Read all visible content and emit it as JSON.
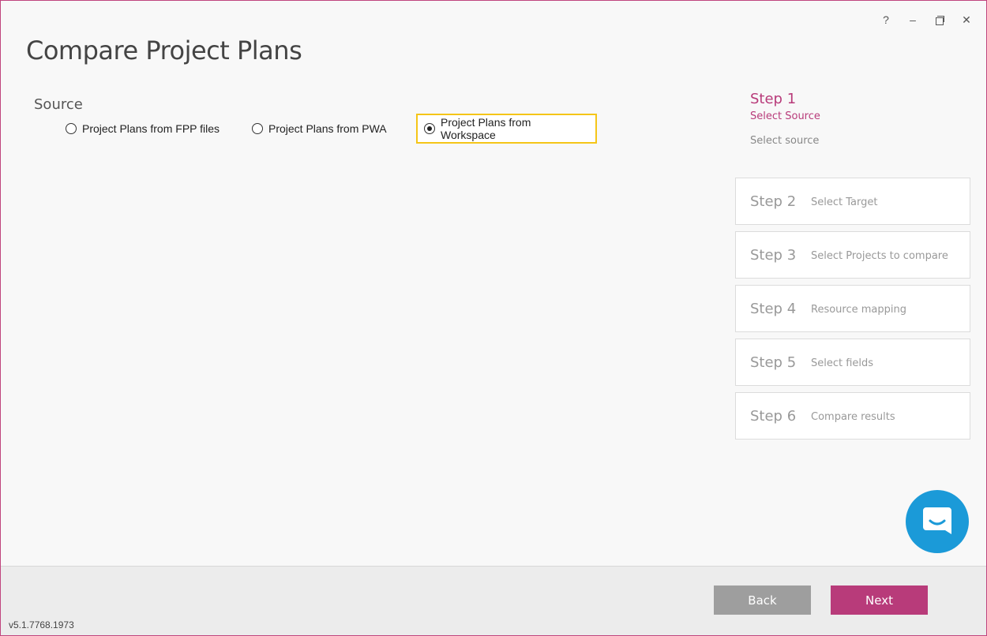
{
  "window": {
    "controls": {
      "help": "?",
      "minimize": "–",
      "close": "✕"
    }
  },
  "page": {
    "title": "Compare Project Plans"
  },
  "source": {
    "label": "Source",
    "options": [
      {
        "label": "Project Plans from FPP files",
        "selected": false
      },
      {
        "label": "Project Plans from PWA",
        "selected": false
      },
      {
        "label": "Project Plans from Workspace",
        "selected": true
      }
    ]
  },
  "steps": {
    "active": {
      "number": "Step 1",
      "name": "Select Source",
      "description": "Select source"
    },
    "pending": [
      {
        "number": "Step 2",
        "name": "Select Target"
      },
      {
        "number": "Step 3",
        "name": "Select Projects to compare"
      },
      {
        "number": "Step 4",
        "name": "Resource mapping"
      },
      {
        "number": "Step 5",
        "name": "Select fields"
      },
      {
        "number": "Step 6",
        "name": "Compare results"
      }
    ]
  },
  "footer": {
    "back_label": "Back",
    "next_label": "Next",
    "version": "v5.1.7768.1973"
  },
  "colors": {
    "accent": "#b83b7a",
    "highlight": "#f5c518",
    "chat": "#1b9ad8",
    "back_button": "#9e9e9e"
  },
  "icons": {
    "help": "help-icon",
    "minimize": "minimize-icon",
    "restore": "restore-icon",
    "close": "close-icon",
    "chat": "chat-icon"
  }
}
